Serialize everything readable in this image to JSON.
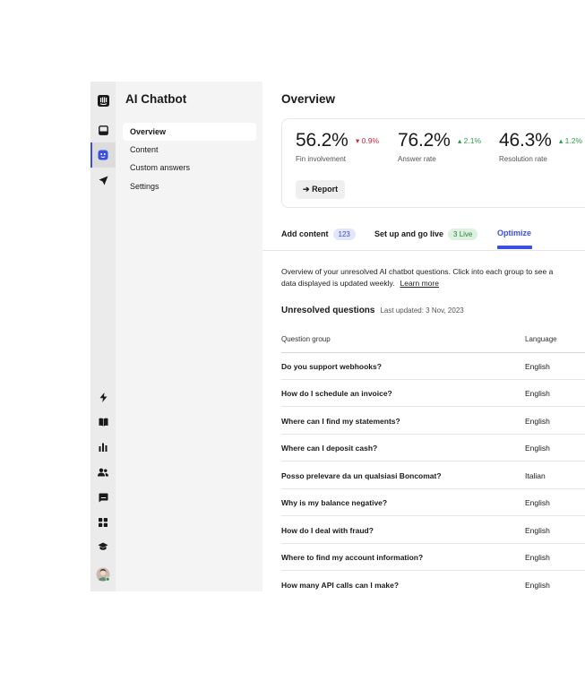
{
  "sidebar": {
    "title": "AI Chatbot",
    "items": [
      {
        "label": "Overview",
        "active": true
      },
      {
        "label": "Content"
      },
      {
        "label": "Custom answers"
      },
      {
        "label": "Settings"
      }
    ]
  },
  "rail": {
    "icons": [
      "logo-icon",
      "inbox-icon",
      "bot-icon",
      "send-icon",
      "bolt-icon",
      "book-icon",
      "reports-icon",
      "contacts-icon",
      "messages-icon",
      "apps-icon",
      "academy-icon",
      "user-avatar"
    ]
  },
  "main": {
    "title": "Overview",
    "metrics": [
      {
        "value": "56.2%",
        "delta": "0.9%",
        "direction": "down",
        "label": "Fin involvement"
      },
      {
        "value": "76.2%",
        "delta": "2.1%",
        "direction": "up",
        "label": "Answer rate"
      },
      {
        "value": "46.3%",
        "delta": "1.2%",
        "direction": "up",
        "label": "Resolution rate"
      }
    ],
    "report_label": "Report",
    "tabs": [
      {
        "label": "Add content",
        "badge": "123"
      },
      {
        "label": "Set up and go live",
        "badge": "3 Live"
      },
      {
        "label": "Optimize",
        "active": true
      }
    ],
    "description_line1": "Overview of your unresolved AI chatbot questions. Click into each group to see a",
    "description_line2": "data displayed is updated weekly.",
    "learn_more": "Learn more",
    "unresolved_title": "Unresolved questions",
    "last_updated": "Last updated: 3 Nov, 2023",
    "table": {
      "columns": [
        "Question group",
        "Language"
      ],
      "rows": [
        [
          "Do you support webhooks?",
          "English"
        ],
        [
          "How do I schedule an invoice?",
          "English"
        ],
        [
          "Where can I find my statements?",
          "English"
        ],
        [
          "Where can I deposit cash?",
          "English"
        ],
        [
          "Posso prelevare da un qualsiasi Boncomat?",
          "Italian"
        ],
        [
          "Why is my balance negative?",
          "English"
        ],
        [
          "How do I deal with fraud?",
          "English"
        ],
        [
          "Where to find my account information?",
          "English"
        ],
        [
          "How many API calls can I make?",
          "English"
        ]
      ]
    }
  },
  "colors": {
    "accent": "#3b4fe0",
    "down": "#d0283a",
    "up": "#2e9a4a"
  }
}
